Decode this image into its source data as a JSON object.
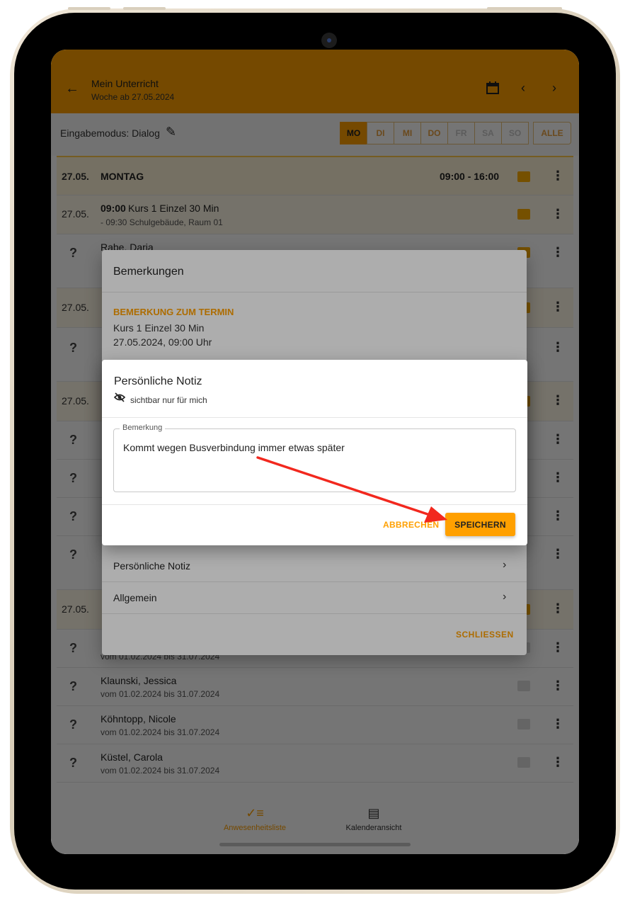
{
  "appbar": {
    "title": "Mein Unterricht",
    "subtitle": "Woche ab 27.05.2024",
    "back_icon": "arrow-left-icon",
    "calendar_icon": "calendar-icon"
  },
  "mode": {
    "label": "Eingabemodus: Dialog",
    "days": [
      "MO",
      "DI",
      "MI",
      "DO",
      "FR",
      "SA",
      "SO"
    ],
    "all": "ALLE",
    "active_day": "MO"
  },
  "list": {
    "day_header": {
      "date": "27.05.",
      "day": "MONTAG",
      "time": "09:00 - 16:00"
    },
    "course": {
      "date": "27.05.",
      "time": "09:00",
      "name": "Kurs 1 Einzel 30 Min",
      "detail": "- 09:30 Schulgebäude, Raum 01"
    },
    "first_person": {
      "mark": "?",
      "name": "Rabe, Daria"
    },
    "date_rows": [
      "27.05.",
      "27.05.",
      "27.05."
    ],
    "mark": "?",
    "persons": [
      {
        "name": "Klaunski, Jessica",
        "period": "vom 01.02.2024 bis 31.07.2024"
      },
      {
        "name": "Köhntopp, Nicole",
        "period": "vom 01.02.2024 bis 31.07.2024"
      },
      {
        "name": "Küstel, Carola",
        "period": "vom 01.02.2024 bis 31.07.2024"
      }
    ],
    "partial_period": "vom 01.02.2024 bis 31.07.2024"
  },
  "bottomnav": {
    "attendance": "Anwesenheitsliste",
    "calendar": "Kalenderansicht"
  },
  "remarks_dialog": {
    "title": "Bemerkungen",
    "section": "BEMERKUNG ZUM TERMIN",
    "course": "Kurs 1 Einzel 30 Min",
    "datetime": "27.05.2024, 09:00 Uhr",
    "item_personal": "Persönliche Notiz",
    "item_general": "Allgemein",
    "close": "SCHLIESSEN"
  },
  "note_dialog": {
    "title": "Persönliche Notiz",
    "visibility": "sichtbar nur für mich",
    "field_label": "Bemerkung",
    "field_value": "Kommt wegen Busverbindung immer etwas später",
    "cancel": "ABBRECHEN",
    "save": "SPEICHERN"
  },
  "colors": {
    "accent": "#ffa000",
    "annotation_arrow": "#f2281e"
  }
}
